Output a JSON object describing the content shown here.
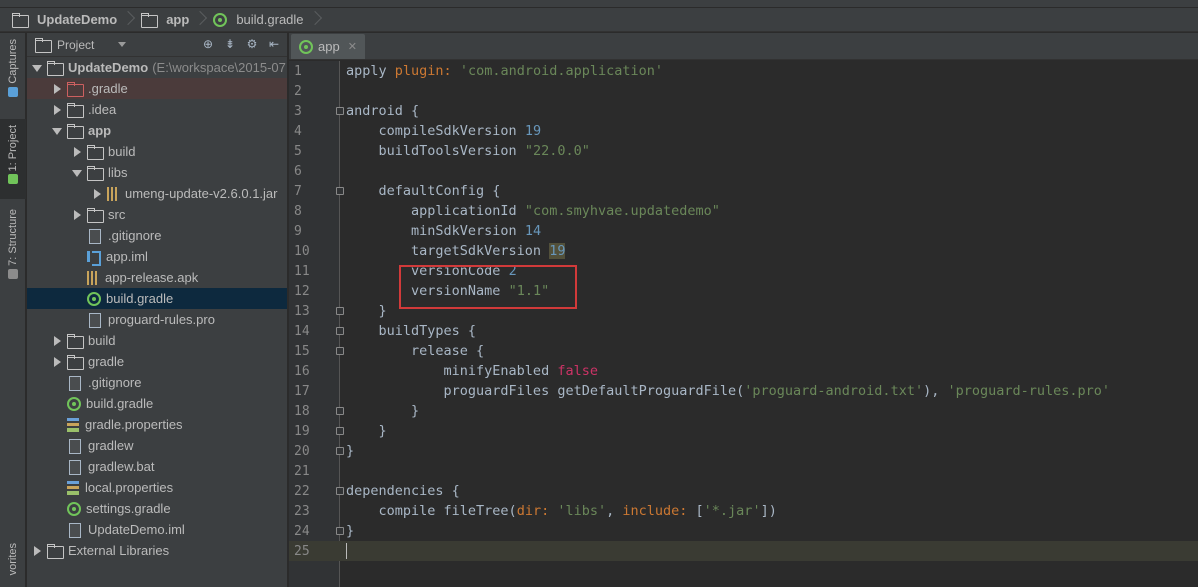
{
  "breadcrumb": [
    "UpdateDemo",
    "app",
    "build.gradle"
  ],
  "tool_strip": {
    "captures": "Captures",
    "project": "1: Project",
    "structure": "7: Structure",
    "favorites": "vorites"
  },
  "project_panel": {
    "title": "Project",
    "tree": [
      {
        "label": "UpdateDemo",
        "path": "(E:\\workspace\\2015-07"
      },
      {
        "label": ".gradle"
      },
      {
        "label": ".idea"
      },
      {
        "label": "app"
      },
      {
        "label": "build"
      },
      {
        "label": "libs"
      },
      {
        "label": "umeng-update-v2.6.0.1.jar"
      },
      {
        "label": "src"
      },
      {
        "label": ".gitignore"
      },
      {
        "label": "app.iml"
      },
      {
        "label": "app-release.apk"
      },
      {
        "label": "build.gradle"
      },
      {
        "label": "proguard-rules.pro"
      },
      {
        "label": "build"
      },
      {
        "label": "gradle"
      },
      {
        "label": ".gitignore"
      },
      {
        "label": "build.gradle"
      },
      {
        "label": "gradle.properties"
      },
      {
        "label": "gradlew"
      },
      {
        "label": "gradlew.bat"
      },
      {
        "label": "local.properties"
      },
      {
        "label": "settings.gradle"
      },
      {
        "label": "UpdateDemo.iml"
      },
      {
        "label": "External Libraries"
      }
    ]
  },
  "editor": {
    "tab_label": "app",
    "line_numbers": [
      "1",
      "2",
      "3",
      "4",
      "5",
      "6",
      "7",
      "8",
      "9",
      "10",
      "11",
      "12",
      "13",
      "14",
      "15",
      "16",
      "17",
      "18",
      "19",
      "20",
      "21",
      "22",
      "23",
      "24",
      "25"
    ],
    "code": {
      "l1a": "apply ",
      "l1b": "plugin: ",
      "l1c": "'com.android.application'",
      "l3": "android {",
      "l4a": "    compileSdkVersion ",
      "l4b": "19",
      "l5a": "    buildToolsVersion ",
      "l5b": "\"22.0.0\"",
      "l7": "    defaultConfig {",
      "l8a": "        applicationId ",
      "l8b": "\"com.smyhvae.updatedemo\"",
      "l9a": "        minSdkVersion ",
      "l9b": "14",
      "l10a": "        targetSdkVersion ",
      "l10b": "19",
      "l11a": "        versionCode ",
      "l11b": "2",
      "l12a": "        versionName ",
      "l12b": "\"1.1\"",
      "l13": "    }",
      "l14": "    buildTypes {",
      "l15": "        release {",
      "l16a": "            minifyEnabled ",
      "l16b": "false",
      "l17a": "            proguardFiles getDefaultProguardFile(",
      "l17b": "'proguard-android.txt'",
      "l17c": "), ",
      "l17d": "'proguard-rules.pro'",
      "l18": "        }",
      "l19": "    }",
      "l20": "}",
      "l22": "dependencies {",
      "l23a": "    compile fileTree(",
      "l23b": "dir: ",
      "l23c": "'libs'",
      "l23d": ", ",
      "l23e": "include: ",
      "l23f": "[",
      "l23g": "'*.jar'",
      "l23h": "])",
      "l24": "}"
    }
  }
}
